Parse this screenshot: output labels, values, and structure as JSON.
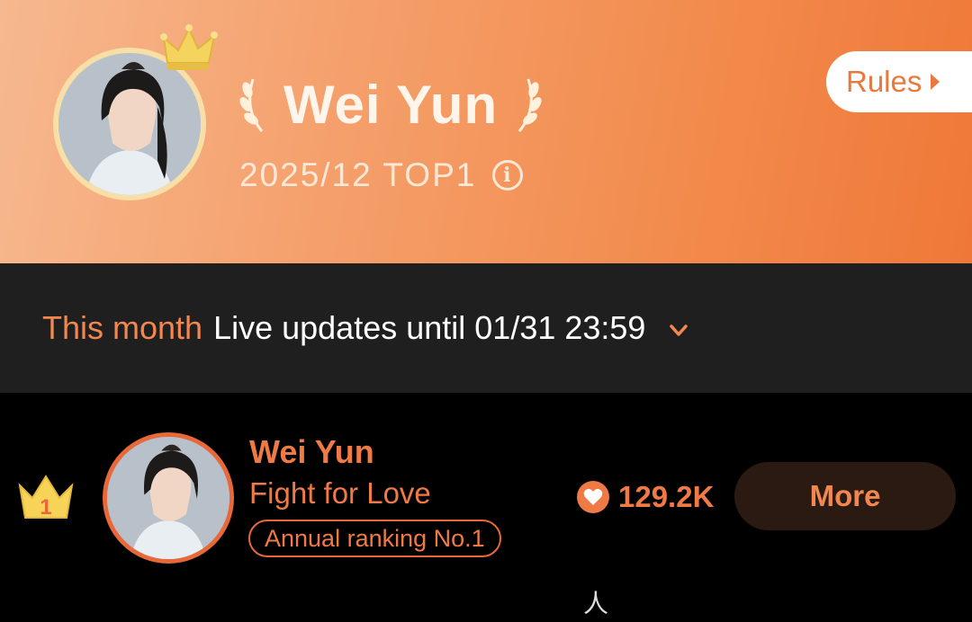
{
  "header": {
    "title": "Wei Yun",
    "subtitle": "2025/12 TOP1",
    "rules_label": "Rules",
    "colors": {
      "gradient_start": "#f6b88e",
      "gradient_end": "#ef7838",
      "crown": "#f4d35e"
    },
    "icons": [
      "crown-icon",
      "laurel-left-icon",
      "laurel-right-icon",
      "info-icon",
      "chevron-right-icon"
    ]
  },
  "period": {
    "label": "This month",
    "text": "Live updates until 01/31 23:59",
    "icon": "chevron-down-icon"
  },
  "ranking": [
    {
      "rank": "1",
      "name": "Wei Yun",
      "drama": "Fight for Love",
      "badge": "Annual ranking No.1",
      "heat": "129.2K",
      "action_label": "More"
    }
  ],
  "footer": {
    "glyph": "人"
  },
  "accent_color": "#ef7a45"
}
